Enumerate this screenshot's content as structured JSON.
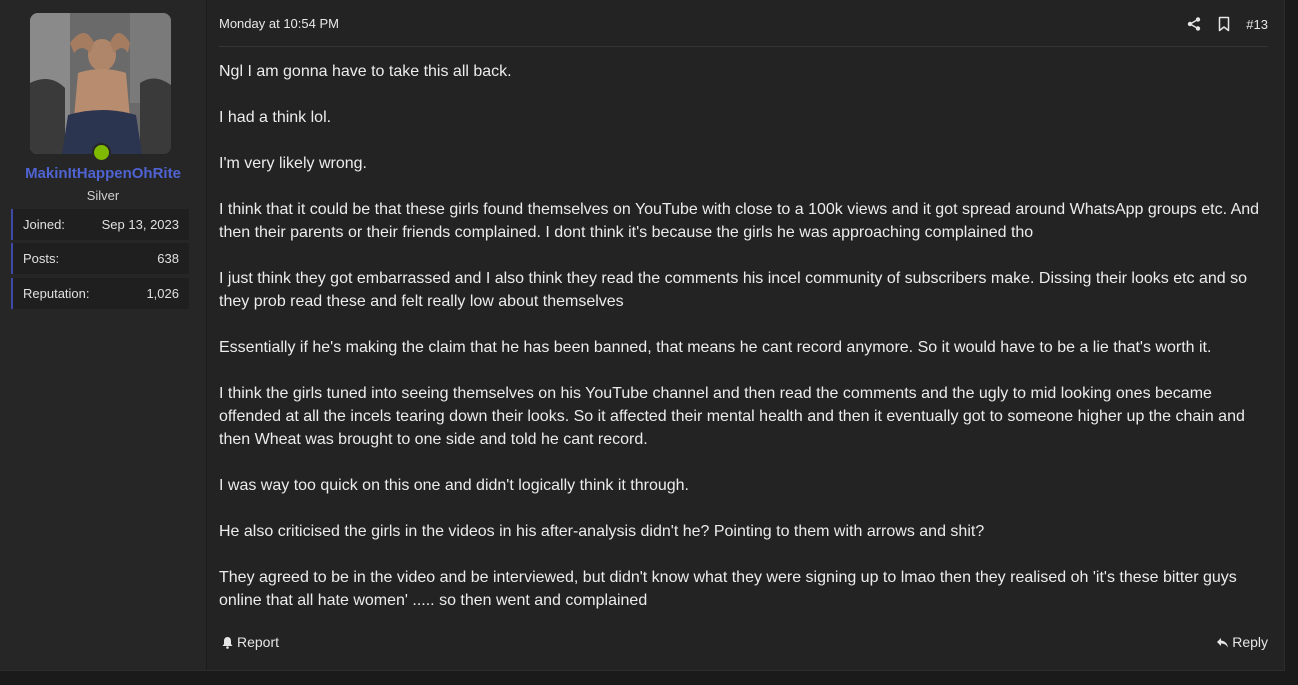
{
  "user": {
    "username": "MakinItHappenOhRite",
    "title": "Silver",
    "online": true,
    "stats": [
      {
        "label": "Joined:",
        "value": "Sep 13, 2023"
      },
      {
        "label": "Posts:",
        "value": "638"
      },
      {
        "label": "Reputation:",
        "value": "1,026"
      }
    ]
  },
  "post": {
    "date": "Monday at 10:54 PM",
    "number": "#13",
    "header_icons": [
      "share-icon",
      "bookmark-icon"
    ],
    "paragraphs": [
      "Ngl I am gonna have to take this all back.",
      "I had a think lol.",
      "I'm very likely wrong.",
      "I think that it could be that these girls found themselves on YouTube with close to a 100k views and it got spread around WhatsApp groups etc. And then their parents or their friends complained. I dont think it's because the girls he was approaching complained tho",
      "I just think they got embarrassed and I also think they read the comments his incel community of subscribers make. Dissing their looks etc and so they prob read these and felt really low about themselves",
      "Essentially if he's making the claim that he has been banned, that means he cant record anymore. So it would have to be a lie that's worth it.",
      "I think the girls tuned into seeing themselves on his YouTube channel and then read the comments and the ugly to mid looking ones became offended at all the incels tearing down their looks. So it affected their mental health and then it eventually got to someone higher up the chain and then Wheat was brought to one side and told he cant record.",
      "I was way too quick on this one and didn't logically think it through.",
      "He also criticised the girls in the videos in his after-analysis didn't he? Pointing to them with arrows and shit?",
      "They agreed to be in the video and be interviewed, but didn't know what they were signing up to lmao then they realised oh 'it's these bitter guys online that all hate women' ..... so then went and complained"
    ]
  },
  "footer": {
    "report_label": "Report",
    "reply_label": "Reply"
  },
  "colors": {
    "username": "#4f63d2",
    "online": "#7fba00",
    "stat_accent": "#3f4aa8",
    "background": "#232323"
  }
}
